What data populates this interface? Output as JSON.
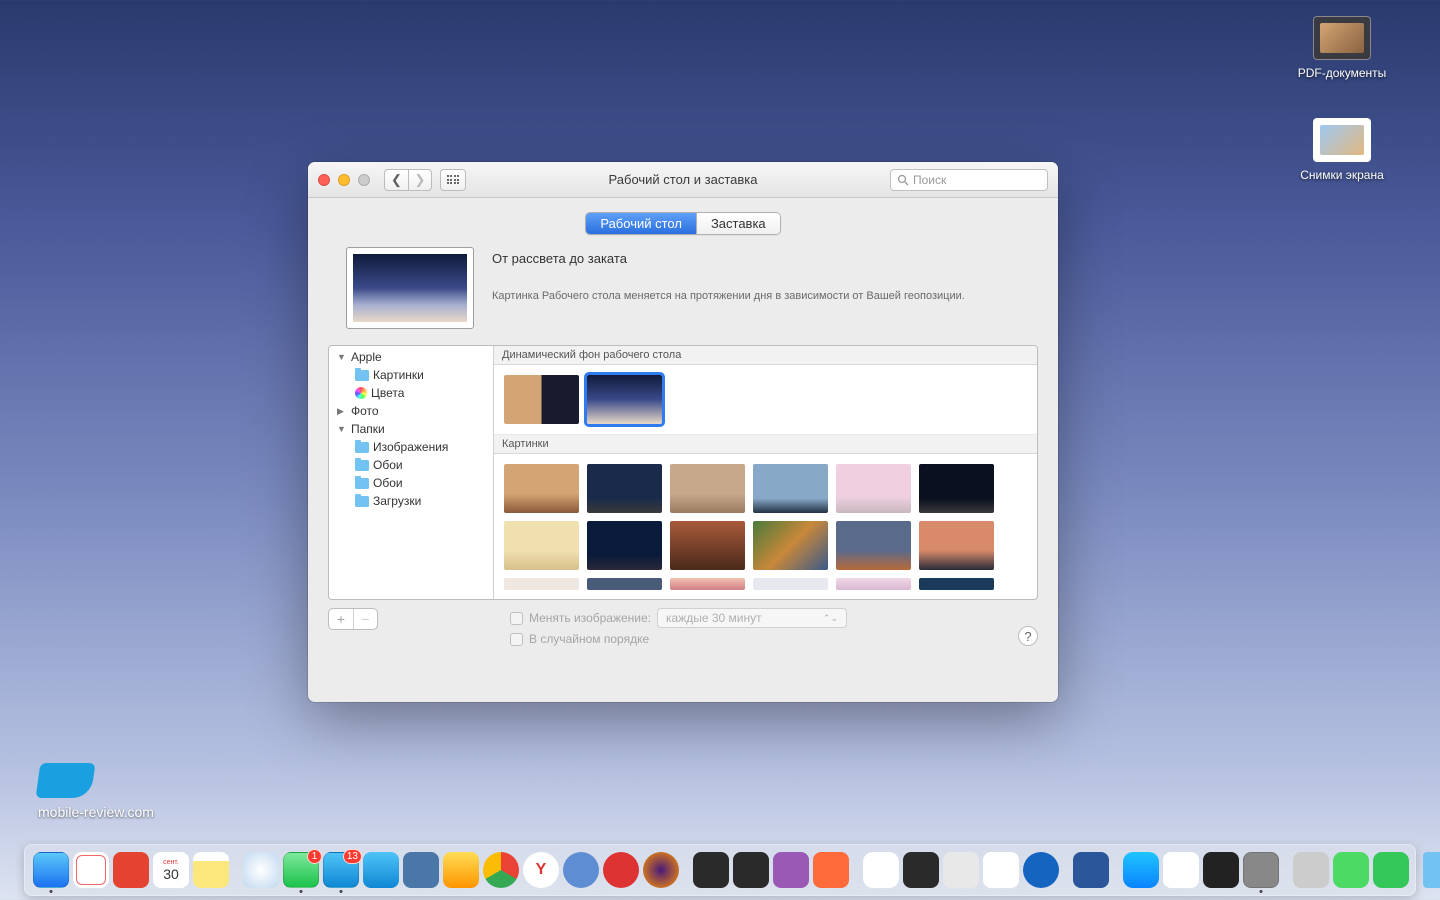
{
  "desktop_icons": [
    {
      "name": "pdf-folder",
      "label": "PDF-документы"
    },
    {
      "name": "screenshots-folder",
      "label": "Снимки экрана"
    }
  ],
  "watermark": "mobile-review.com",
  "window": {
    "title": "Рабочий стол и заставка",
    "search_placeholder": "Поиск",
    "tabs": {
      "desktop": "Рабочий стол",
      "screensaver": "Заставка"
    },
    "preview": {
      "title": "От рассвета до заката",
      "description": "Картинка Рабочего стола меняется на протяжении дня в зависимости от Вашей геопозиции."
    },
    "sidebar": {
      "apple": "Apple",
      "pictures": "Картинки",
      "colors": "Цвета",
      "photo": "Фото",
      "folders": "Папки",
      "images": "Изображения",
      "wallpapers1": "Обои",
      "wallpapers2": "Обои",
      "downloads": "Загрузки"
    },
    "sections": {
      "dynamic": "Динамический фон рабочего стола",
      "pictures": "Картинки"
    },
    "footer": {
      "change_picture": "Менять изображение:",
      "random": "В случайном порядке",
      "interval": "каждые 30 минут"
    }
  },
  "dock": {
    "messages_badge": "1",
    "telegram_badge": "13",
    "calendar_label_month": "сент.",
    "calendar_label_day": "30"
  }
}
